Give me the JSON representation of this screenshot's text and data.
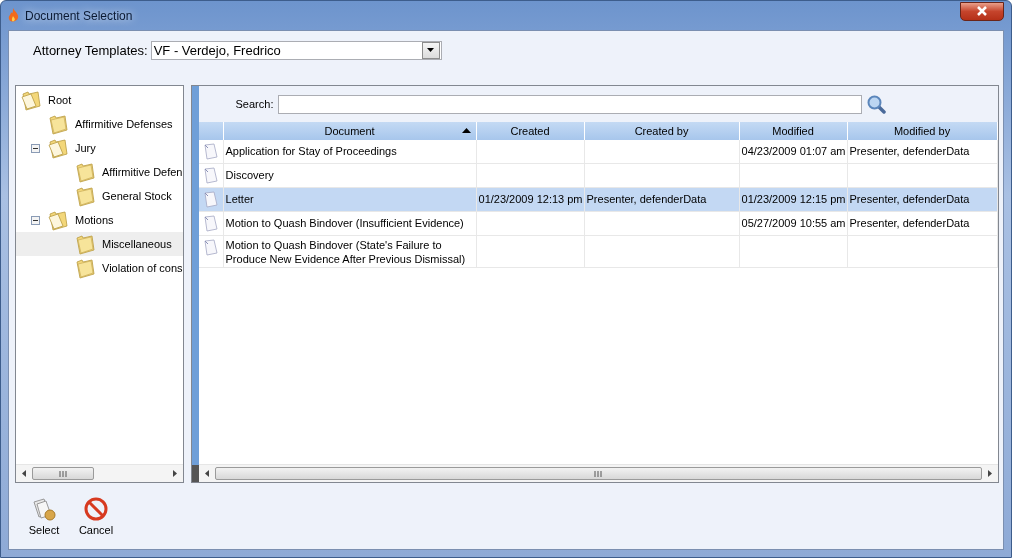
{
  "window": {
    "title": "Document Selection"
  },
  "attorney_templates": {
    "label": "Attorney Templates:",
    "value": "VF - Verdejo, Fredrico"
  },
  "tree": [
    {
      "label": "Root",
      "selected": false,
      "children": [
        {
          "label": "Affirmitive Defenses",
          "selected": false
        },
        {
          "label": "Jury",
          "selected": false,
          "expanded": true,
          "children": [
            {
              "label": "Affirmitive Defen",
              "selected": false
            },
            {
              "label": "General Stock",
              "selected": false
            }
          ]
        },
        {
          "label": "Motions",
          "selected": false,
          "expanded": true,
          "children": [
            {
              "label": "Miscellaneous",
              "selected": true
            },
            {
              "label": "Violation of cons",
              "selected": false
            }
          ]
        }
      ]
    }
  ],
  "search": {
    "label": "Search:"
  },
  "table": {
    "columns": [
      {
        "label": "Document",
        "sort_ascending": true
      },
      {
        "label": "Created"
      },
      {
        "label": "Created by"
      },
      {
        "label": "Modified"
      },
      {
        "label": "Modified by"
      }
    ],
    "rows": [
      {
        "selected": false,
        "cells": [
          "Application for Stay of Proceedings",
          "",
          "",
          "04/23/2009 01:07 am",
          "Presenter, defenderData"
        ]
      },
      {
        "selected": false,
        "cells": [
          "Discovery",
          "",
          "",
          "",
          ""
        ]
      },
      {
        "selected": true,
        "cells": [
          "Letter",
          "01/23/2009 12:13 pm",
          "Presenter, defenderData",
          "01/23/2009 12:15 pm",
          "Presenter, defenderData"
        ]
      },
      {
        "selected": false,
        "cells": [
          "Motion to Quash Bindover (Insufficient Evidence)",
          "",
          "",
          "05/27/2009 10:55 am",
          "Presenter, defenderData"
        ]
      },
      {
        "selected": false,
        "cells": [
          "Motion to Quash Bindover (State's Failure to Produce New Evidence After Previous Dismissal)",
          "",
          "",
          "",
          ""
        ]
      }
    ]
  },
  "buttons": [
    {
      "label": "Select",
      "kind": "select"
    },
    {
      "label": "Cancel",
      "kind": "cancel"
    }
  ]
}
